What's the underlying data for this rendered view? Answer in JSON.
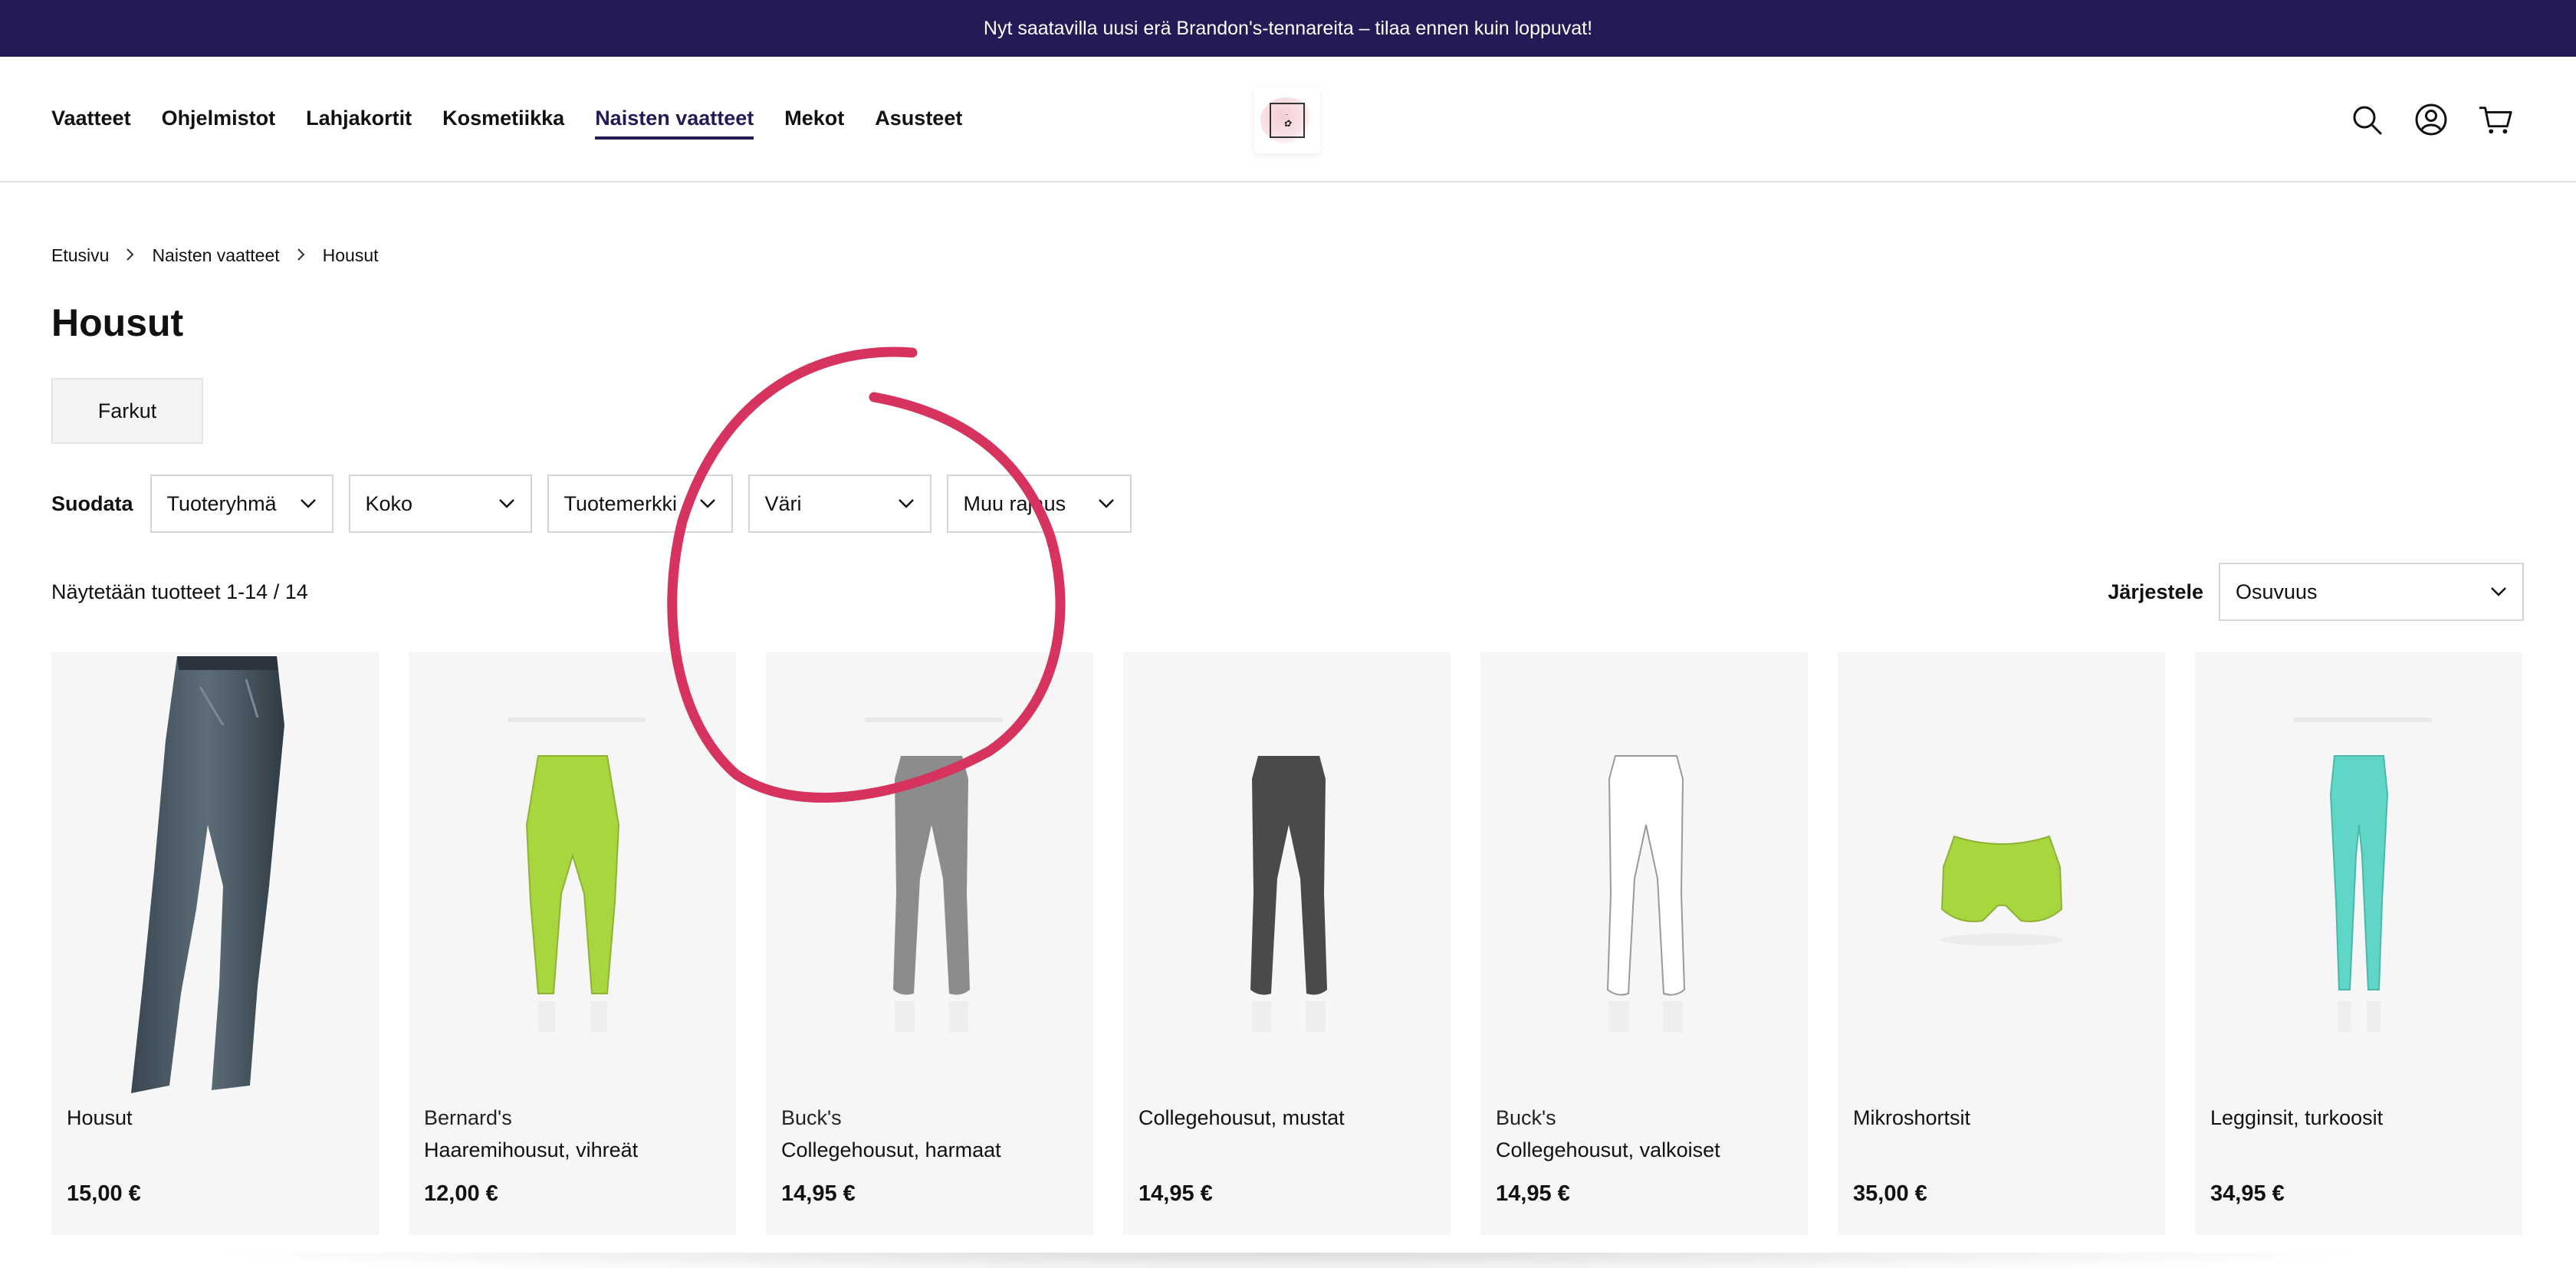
{
  "announcement": {
    "text": "Nyt saatavilla uusi erä Brandon's-tennareita – tilaa ennen kuin loppuvat!"
  },
  "nav": {
    "items": [
      {
        "label": "Vaatteet"
      },
      {
        "label": "Ohjelmistot"
      },
      {
        "label": "Lahjakortit"
      },
      {
        "label": "Kosmetiikka"
      },
      {
        "label": "Naisten vaatteet",
        "active": true
      },
      {
        "label": "Mekot"
      },
      {
        "label": "Asusteet"
      }
    ]
  },
  "header_icons": [
    "search-icon",
    "account-icon",
    "cart-icon"
  ],
  "breadcrumb": [
    {
      "label": "Etusivu"
    },
    {
      "label": "Naisten vaatteet"
    },
    {
      "label": "Housut"
    }
  ],
  "page": {
    "title": "Housut",
    "subcategory": "Farkut"
  },
  "filters": {
    "label": "Suodata",
    "selects": [
      "Tuoteryhmä",
      "Koko",
      "Tuotemerkki",
      "Väri",
      "Muu rajaus"
    ]
  },
  "results": {
    "count_text": "Näytetään tuotteet 1-14 / 14"
  },
  "sort": {
    "label": "Järjestele",
    "value": "Osuvuus"
  },
  "products": [
    {
      "brand": "",
      "name": "Housut",
      "price": "15,00 €",
      "image": "jeans"
    },
    {
      "brand": "Bernard's",
      "name": "Haaremihousut, vihreät",
      "price": "12,00 €",
      "image": "harem-pants-green"
    },
    {
      "brand": "Buck's",
      "name": "Collegehousut, harmaat",
      "price": "14,95 €",
      "image": "sweatpants-grey"
    },
    {
      "brand": "",
      "name": "Collegehousut, mustat",
      "price": "14,95 €",
      "image": "sweatpants-black"
    },
    {
      "brand": "Buck's",
      "name": "Collegehousut, valkoiset",
      "price": "14,95 €",
      "image": "sweatpants-white"
    },
    {
      "brand": "",
      "name": "Mikroshortsit",
      "price": "35,00 €",
      "image": "shorts-green"
    },
    {
      "brand": "",
      "name": "Legginsit, turkoosit",
      "price": "34,95 €",
      "image": "leggings-turquoise"
    }
  ],
  "colors": {
    "announcement_bg": "#231b55",
    "active_nav": "#231b55",
    "annotation": "#d6335f",
    "harem_green": "#a8d63f",
    "grey_pants": "#8c8c8c",
    "black_pants": "#4a4a4a",
    "turquoise": "#5fd6c6"
  }
}
